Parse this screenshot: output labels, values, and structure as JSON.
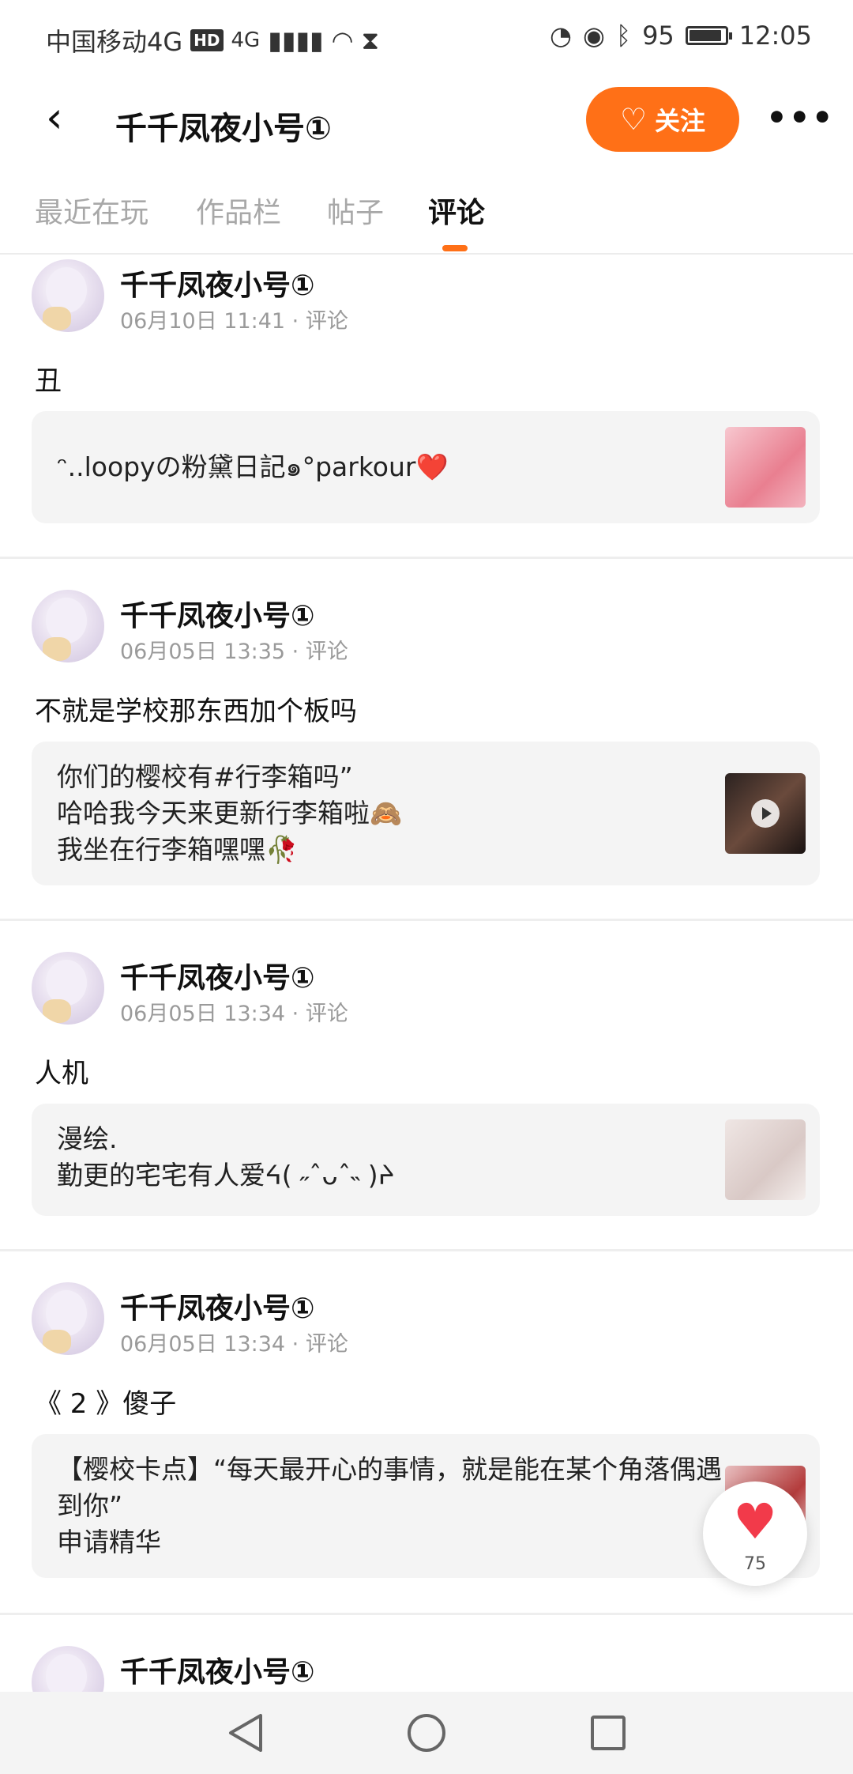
{
  "status_bar": {
    "carrier": "中国移动4G",
    "hd": "HD",
    "network": "4G",
    "battery": "95",
    "battery_level": 0.95,
    "time": "12:05"
  },
  "header": {
    "back_icon": "chevron-left-icon",
    "title": "千千凤夜小号①",
    "follow_label": "关注",
    "follow_color": "#ff7017",
    "more_icon": "more-horizontal-icon"
  },
  "tabs": [
    {
      "label": "最近在玩",
      "active": false
    },
    {
      "label": "作品栏",
      "active": false
    },
    {
      "label": "帖子",
      "active": false
    },
    {
      "label": "评论",
      "active": true
    }
  ],
  "posts": [
    {
      "author": "千千凤夜小号①",
      "meta": "06月10日 11:41 · 评论",
      "comment": "丑",
      "quote": "ᵔ..loopyの粉黛日記๑°parkour❤️",
      "thumb": "pink"
    },
    {
      "author": "千千凤夜小号①",
      "meta": "06月05日 13:35 · 评论",
      "comment": "不就是学校那东西加个板吗",
      "quote": "你们的樱校有#行李箱吗”\n哈哈我今天来更新行李箱啦🙈\n我坐在行李箱嘿嘿🥀",
      "thumb": "dark-video"
    },
    {
      "author": "千千凤夜小号①",
      "meta": "06月05日 13:34 · 评论",
      "comment": "人机",
      "quote": "漫绘.\n勤更的宅宅有人爱ᔦ( ˶ˆᴗˆ˵ )ᔨ",
      "thumb": "sketch"
    },
    {
      "author": "千千凤夜小号①",
      "meta": "06月05日 13:34 · 评论",
      "comment": "《 2 》傻子",
      "quote": "【樱校卡点】“每天最开心的事情，就是能在某个角落偶遇到你”\n申请精华",
      "thumb": "red"
    },
    {
      "author": "千千凤夜小号①"
    }
  ],
  "like_fab": {
    "icon": "heart-icon",
    "count": "75",
    "color": "#f23a4a"
  },
  "navbar": {
    "back_icon": "nav-back-icon",
    "home_icon": "nav-home-icon",
    "recent_icon": "nav-recent-icon"
  }
}
